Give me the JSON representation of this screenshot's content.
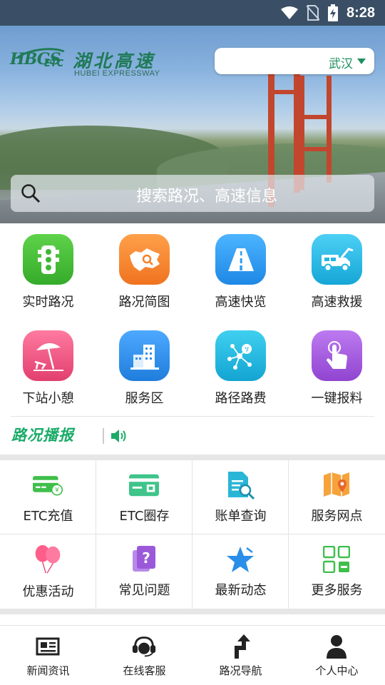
{
  "status_bar": {
    "time": "8:28"
  },
  "header": {
    "logo_mark": "HBGS",
    "logo_etc": "ETC",
    "logo_cn": "湖北高速",
    "logo_en": "HUBEI EXPRESSWAY",
    "city": "武汉"
  },
  "search": {
    "placeholder": "搜索路况、高速信息"
  },
  "quick_grid": [
    {
      "label": "实时路况",
      "icon": "traffic-light-icon",
      "color": "#3fb835"
    },
    {
      "label": "路况简图",
      "icon": "map-hubei-icon",
      "color": "#f2822a"
    },
    {
      "label": "高速快览",
      "icon": "highway-icon",
      "color": "#2e9df0"
    },
    {
      "label": "高速救援",
      "icon": "tow-truck-icon",
      "color": "#23b6e3"
    },
    {
      "label": "下站小憩",
      "icon": "beach-umbrella-icon",
      "color": "#ec4d7b"
    },
    {
      "label": "服务区",
      "icon": "building-icon",
      "color": "#2f8fe8"
    },
    {
      "label": "路径路费",
      "icon": "route-fee-icon",
      "color": "#1fb3dc"
    },
    {
      "label": "一键报料",
      "icon": "tap-hand-icon",
      "color": "#a458d8"
    }
  ],
  "news": {
    "title": "路况播报"
  },
  "service_grid": [
    {
      "label": "ETC充值",
      "icon": "etc-card-recharge-icon"
    },
    {
      "label": "ETC圈存",
      "icon": "etc-card-load-icon"
    },
    {
      "label": "账单查询",
      "icon": "bill-search-icon"
    },
    {
      "label": "服务网点",
      "icon": "map-pin-icon"
    },
    {
      "label": "优惠活动",
      "icon": "balloons-icon"
    },
    {
      "label": "常见问题",
      "icon": "question-cards-icon"
    },
    {
      "label": "最新动态",
      "icon": "star-icon"
    },
    {
      "label": "更多服务",
      "icon": "more-grid-icon"
    }
  ],
  "tab_bar": [
    {
      "label": "新闻资讯",
      "icon": "newspaper-icon"
    },
    {
      "label": "在线客服",
      "icon": "headset-icon"
    },
    {
      "label": "路况导航",
      "icon": "turn-arrow-icon"
    },
    {
      "label": "个人中心",
      "icon": "person-icon"
    }
  ],
  "colors": {
    "brand_green": "#1e8f5e",
    "accent_green": "#1aab68",
    "status_bar": "#3a4f66"
  }
}
